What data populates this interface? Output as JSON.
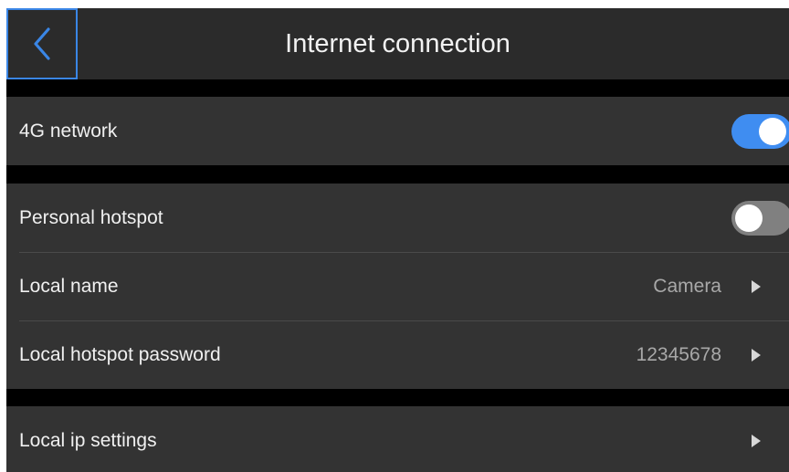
{
  "header": {
    "title": "Internet connection",
    "back_icon": "chevron-left-icon",
    "accent_color": "#3a86e6"
  },
  "network": {
    "label": "4G network",
    "enabled": true
  },
  "hotspot": {
    "personal_label": "Personal hotspot",
    "personal_enabled": false,
    "local_name_label": "Local name",
    "local_name_value": "Camera",
    "password_label": "Local hotspot password",
    "password_value": "12345678"
  },
  "ip": {
    "label": "Local ip settings"
  },
  "colors": {
    "toggle_on": "#3f8df1",
    "toggle_off": "#808080",
    "panel": "#333333",
    "background": "#000000"
  }
}
